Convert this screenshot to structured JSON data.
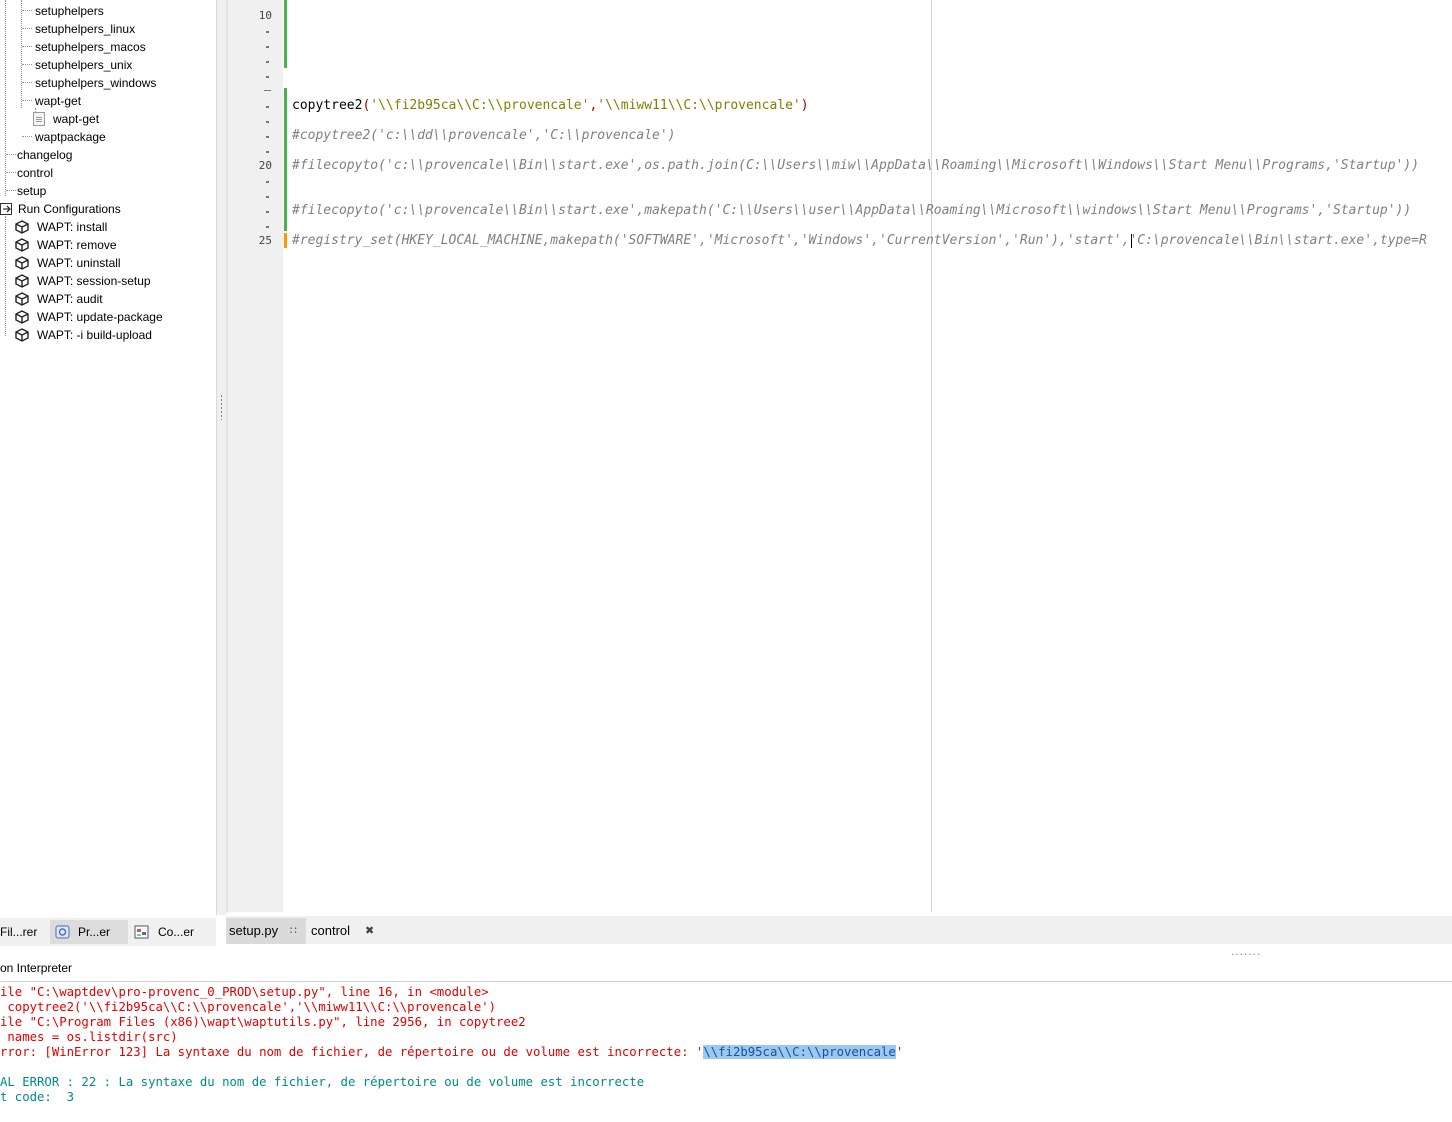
{
  "project_tree": {
    "items": [
      {
        "label": "setuphelpers",
        "kind": "module"
      },
      {
        "label": "setuphelpers_linux",
        "kind": "module"
      },
      {
        "label": "setuphelpers_macos",
        "kind": "module"
      },
      {
        "label": "setuphelpers_unix",
        "kind": "module"
      },
      {
        "label": "setuphelpers_windows",
        "kind": "module"
      },
      {
        "label": "wapt-get",
        "kind": "module"
      },
      {
        "label": "wapt-get",
        "kind": "file"
      },
      {
        "label": "waptpackage",
        "kind": "module"
      },
      {
        "label": "changelog",
        "kind": "folder"
      },
      {
        "label": "control",
        "kind": "folder"
      },
      {
        "label": "setup",
        "kind": "folder"
      }
    ],
    "run_configurations": {
      "label": "Run Configurations",
      "items": [
        "WAPT: install",
        "WAPT: remove",
        "WAPT: uninstall",
        "WAPT: session-setup",
        "WAPT: audit",
        "WAPT: update-package",
        "WAPT: -i build-upload"
      ]
    }
  },
  "left_panel_tabs": [
    "Fil...rer",
    "Pr...er",
    "Co...er"
  ],
  "editor": {
    "line_numbers": [
      "10",
      "20",
      "25"
    ],
    "lines": [
      {
        "segments": [
          {
            "t": "copytree2",
            "c": "fn"
          },
          {
            "t": "(",
            "c": "pn"
          },
          {
            "t": "'\\\\fi2b95ca\\\\C:\\\\provencale'",
            "c": "st"
          },
          {
            "t": ",",
            "c": "pn"
          },
          {
            "t": "'\\\\miww11\\\\C:\\\\provencale'",
            "c": "st"
          },
          {
            "t": ")",
            "c": "pn"
          }
        ]
      },
      {
        "segments": [
          {
            "t": "#copytree2('c:\\\\dd\\\\provencale','C:\\\\provencale')",
            "c": "cm"
          }
        ]
      },
      {
        "segments": [
          {
            "t": "#filecopyto('c:\\\\provencale\\\\Bin\\\\start.exe',os.path.join(C:\\\\Users\\\\miw\\\\AppData\\\\Roaming\\\\Microsoft\\\\Windows\\\\Start Menu\\\\Programs,'Startup'))",
            "c": "cm"
          }
        ]
      },
      {
        "segments": [
          {
            "t": "#filecopyto('c:\\\\provencale\\\\Bin\\\\start.exe',makepath('C:\\\\Users\\\\user\\\\AppData\\\\Roaming\\\\Microsoft\\\\windows\\\\Start Menu\\\\Programs','Startup'))",
            "c": "cm"
          }
        ]
      },
      {
        "segments": [
          {
            "t": "#registry_set(HKEY_LOCAL_MACHINE,makepath('SOFTWARE','Microsoft','Windows','CurrentVersion','Run'),'start','C:\\provencale\\\\Bin\\\\start.exe',type=R",
            "c": "cm"
          }
        ]
      }
    ]
  },
  "editor_tabs": [
    {
      "label": "setup.py",
      "close_glyph": "∷",
      "active": true
    },
    {
      "label": "control",
      "close_glyph": "✖",
      "active": false
    }
  ],
  "interpreter": {
    "title": "on Interpreter",
    "lines": [
      {
        "text": "ile \"C:\\waptdev\\pro-provenc_0_PROD\\setup.py\", line 16, in <module>",
        "kind": "err"
      },
      {
        "text": " copytree2('\\\\fi2b95ca\\\\C:\\\\provencale','\\\\miww11\\\\C:\\\\provencale')",
        "kind": "err"
      },
      {
        "text": "ile \"C:\\Program Files (x86)\\wapt\\waptutils.py\", line 2956, in copytree2",
        "kind": "err"
      },
      {
        "text": " names = os.listdir(src)",
        "kind": "err"
      },
      {
        "text": "rror: [WinError 123] La syntaxe du nom de fichier, de répertoire ou de volume est incorrecte: '",
        "kind": "err",
        "selected": "\\\\fi2b95ca\\\\C:\\\\provencale",
        "after": "'"
      },
      {
        "text": "",
        "kind": "info"
      },
      {
        "text": "AL ERROR : 22 : La syntaxe du nom de fichier, de répertoire ou de volume est incorrecte",
        "kind": "info"
      },
      {
        "text": "t code:  3",
        "kind": "info"
      }
    ]
  },
  "colors": {
    "string": "#808000",
    "comment": "#808080",
    "paren": "#990000",
    "change_saved": "#4caf50",
    "change_unsaved": "#ff9800",
    "error": "#e00000",
    "info": "#008b8b",
    "selection": "#99c9ef"
  }
}
